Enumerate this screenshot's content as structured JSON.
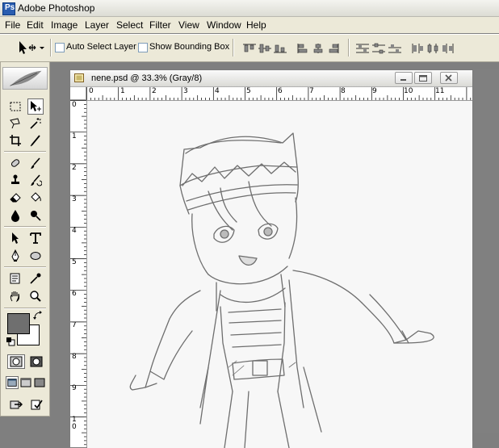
{
  "app": {
    "title": "Adobe Photoshop"
  },
  "menu": [
    "File",
    "Edit",
    "Image",
    "Layer",
    "Select",
    "Filter",
    "View",
    "Window",
    "Help"
  ],
  "options": {
    "auto_select_label": "Auto Select Layer",
    "bounding_box_label": "Show Bounding Box"
  },
  "document": {
    "title": "nene.psd @ 33.3% (Gray/8)",
    "ruler_top": [
      "0",
      "1",
      "2",
      "3",
      "4",
      "5",
      "6",
      "7",
      "8",
      "9",
      "10",
      "11"
    ],
    "ruler_left": [
      "0",
      "1",
      "2",
      "3",
      "4",
      "5",
      "6",
      "7",
      "8",
      "9",
      "1",
      "0"
    ]
  },
  "colors": {
    "foreground": "#6f6f6f",
    "background": "#ffffff",
    "app_bg": "#7f7f7f"
  },
  "icons": {
    "tools": [
      "marquee-icon",
      "move-icon",
      "lasso-icon",
      "magic-wand-icon",
      "crop-icon",
      "slice-icon",
      "healing-brush-icon",
      "brush-icon",
      "clone-stamp-icon",
      "history-brush-icon",
      "eraser-icon",
      "paint-bucket-icon",
      "blur-icon",
      "dodge-icon",
      "path-select-icon",
      "type-icon",
      "pen-icon",
      "shape-icon",
      "notes-icon",
      "eyedropper-icon",
      "hand-icon",
      "zoom-icon"
    ]
  }
}
